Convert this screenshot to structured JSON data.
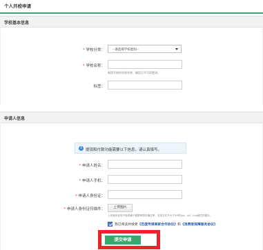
{
  "page": {
    "title": "个人开校申请"
  },
  "school_section": {
    "heading": "学校基本信息",
    "category": {
      "label": "学校分类：",
      "selected": "--请选择学校类别--"
    },
    "name": {
      "label": "学校名称：",
      "value": "",
      "hint": "新提开校的学校名称，确定后不可再更改。"
    },
    "tags": {
      "label": "标签：",
      "value": ""
    }
  },
  "applicant_section": {
    "heading": "申请人信息",
    "notice": "提现和付款功能需要以下信息，请认真填写。",
    "applicant_name": {
      "label": "申请人姓名：",
      "value": ""
    },
    "applicant_phone": {
      "label": "申请人手机：",
      "value": ""
    },
    "applicant_id": {
      "label": "申请人身份证：",
      "value": ""
    },
    "id_scan": {
      "label": "申请人身份证扫描件：",
      "upload_label": "上传图片",
      "hint": "上传身份证电子版资格个额图审核的通过率。支持文件不大于5M的jpg、gif、png格式的图片。"
    },
    "agreement": {
      "checked": true,
      "prefix": "我已阅读并接受",
      "link1": "《百度传课商家合作协议》",
      "middle": "和",
      "link2": "《消费者保障服务协议》"
    },
    "submit_label": "提交申请"
  },
  "colors": {
    "accent": "#3aa76d",
    "highlight_border": "#e8232a",
    "required": "#e33333",
    "link": "#2a5aa8"
  }
}
